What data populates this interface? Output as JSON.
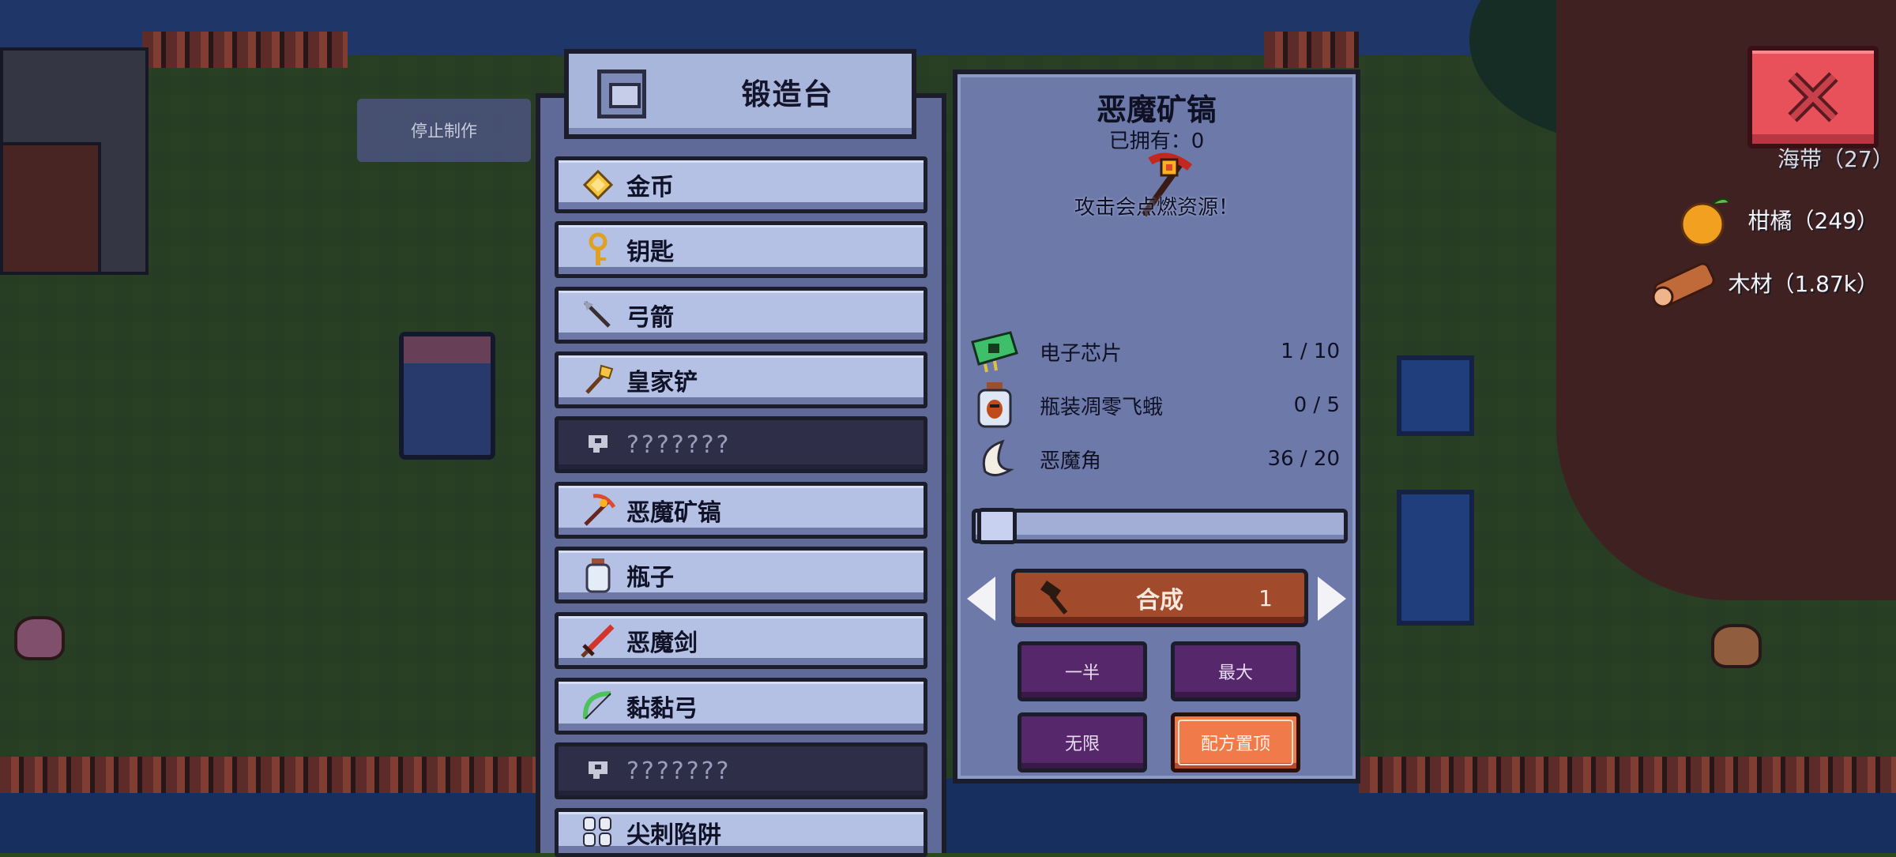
{
  "stop_crafting_label": "停止制作",
  "station": {
    "title": "锻造台",
    "icon": "forge-icon"
  },
  "recipes": [
    {
      "label": "金币",
      "icon": "gold-coin-icon",
      "locked": false
    },
    {
      "label": "钥匙",
      "icon": "key-icon",
      "locked": false
    },
    {
      "label": "弓箭",
      "icon": "arrow-icon",
      "locked": false
    },
    {
      "label": "皇家铲",
      "icon": "royal-shovel-icon",
      "locked": false
    },
    {
      "label": "???????",
      "icon": "locked-icon",
      "locked": true
    },
    {
      "label": "恶魔矿镐",
      "icon": "demon-pickaxe-icon",
      "locked": false
    },
    {
      "label": "瓶子",
      "icon": "bottle-icon",
      "locked": false
    },
    {
      "label": "恶魔剑",
      "icon": "demon-sword-icon",
      "locked": false
    },
    {
      "label": "黏黏弓",
      "icon": "slime-bow-icon",
      "locked": false
    },
    {
      "label": "???????",
      "icon": "locked-icon",
      "locked": true
    },
    {
      "label": "尖刺陷阱",
      "icon": "spike-trap-icon",
      "locked": false
    }
  ],
  "detail": {
    "title": "恶魔矿镐",
    "owned": "已拥有：0",
    "icon": "demon-pickaxe-icon",
    "description": "攻击会点燃资源！",
    "ingredients": [
      {
        "name": "电子芯片",
        "count": "1 / 10",
        "icon": "microchip-icon"
      },
      {
        "name": "瓶装凋零飞蛾",
        "count": "0 / 5",
        "icon": "bottled-moth-icon"
      },
      {
        "name": "恶魔角",
        "count": "36 / 20",
        "icon": "demon-horn-icon"
      }
    ],
    "quantity_slider_fraction": 0.0,
    "craft": {
      "label": "合成",
      "quantity": "1",
      "icon": "hammer-icon"
    },
    "buttons": {
      "half": "一半",
      "max": "最大",
      "infinite": "无限",
      "pin_recipe": "配方置顶"
    }
  },
  "resources": [
    {
      "name": "海带（27）",
      "icon": "seaweed-icon"
    },
    {
      "name": "柑橘（249）",
      "icon": "citrus-icon"
    },
    {
      "name": "木材（1.87k）",
      "icon": "wood-icon"
    }
  ],
  "close_icon": "close-icon",
  "colors": {
    "panel": "#6d79a8",
    "row": "#b4c0e4",
    "locked_row": "#2e2e48",
    "craft_button": "#a14a2c",
    "purple_button": "#56276a",
    "pin_button": "#f07a4a",
    "close_button": "#e8515a"
  }
}
